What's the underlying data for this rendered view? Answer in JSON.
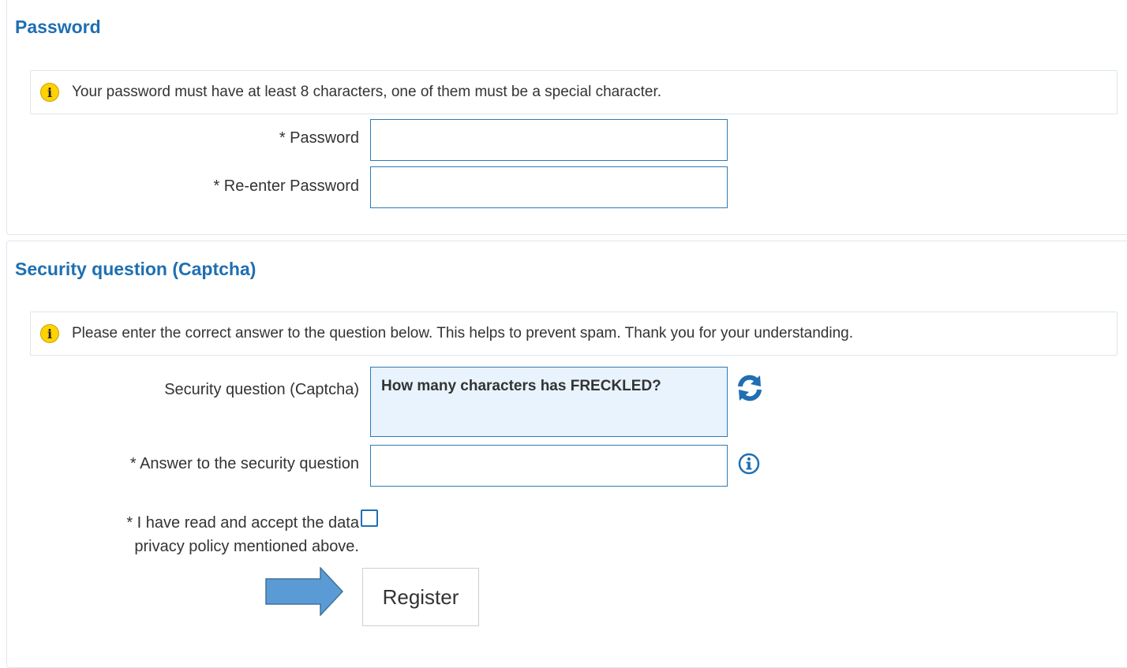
{
  "password_section": {
    "title": "Password",
    "info": "Your password must have at least 8 characters, one of them must be a special character.",
    "password_label": "* Password",
    "password_value": "",
    "reenter_label": "* Re-enter Password",
    "reenter_value": ""
  },
  "captcha_section": {
    "title": "Security question (Captcha)",
    "info": "Please enter the correct answer to the question below. This helps to prevent spam. Thank you for your understanding.",
    "question_label": "Security question (Captcha)",
    "question_text": "How many characters has FRECKLED?",
    "answer_label": "* Answer to the security question",
    "answer_value": "",
    "privacy_line1": "* I have read and accept the data",
    "privacy_line2": "privacy policy mentioned above.",
    "privacy_checked": false,
    "register_label": "Register"
  },
  "colors": {
    "heading": "#1f6fb2",
    "info_icon": "#ffd200",
    "input_border": "#2f7ab5",
    "captcha_bg": "#e8f3fd",
    "arrow": "#5b9bd5"
  },
  "icons": {
    "info": "info-circle-yellow",
    "refresh": "refresh-arrows",
    "help": "info-circle-outline",
    "pointer": "right-arrow"
  }
}
